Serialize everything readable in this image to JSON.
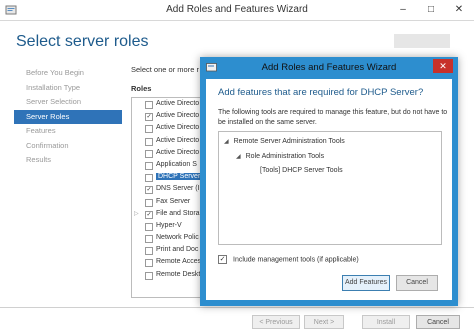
{
  "window": {
    "title": "Add Roles and Features Wizard"
  },
  "header": {
    "page_title": "Select server roles"
  },
  "sidebar": {
    "items": [
      {
        "label": "Before You Begin",
        "active": false
      },
      {
        "label": "Installation Type",
        "active": false
      },
      {
        "label": "Server Selection",
        "active": false
      },
      {
        "label": "Server Roles",
        "active": true
      },
      {
        "label": "Features",
        "active": false
      },
      {
        "label": "Confirmation",
        "active": false
      },
      {
        "label": "Results",
        "active": false
      }
    ]
  },
  "content": {
    "instruction": "Select one or more r",
    "roles_heading": "Roles",
    "roles": [
      {
        "label": "Active Directo",
        "checked": false,
        "expandable": false,
        "selected": false
      },
      {
        "label": "Active Directo",
        "checked": true,
        "expandable": false,
        "selected": false
      },
      {
        "label": "Active Directo",
        "checked": false,
        "expandable": false,
        "selected": false
      },
      {
        "label": "Active Directo",
        "checked": false,
        "expandable": false,
        "selected": false
      },
      {
        "label": "Active Directo",
        "checked": false,
        "expandable": false,
        "selected": false
      },
      {
        "label": "Application S",
        "checked": false,
        "expandable": false,
        "selected": false
      },
      {
        "label": "DHCP Server",
        "checked": false,
        "expandable": false,
        "selected": true
      },
      {
        "label": "DNS Server (I",
        "checked": true,
        "expandable": false,
        "selected": false
      },
      {
        "label": "Fax Server",
        "checked": false,
        "expandable": false,
        "selected": false
      },
      {
        "label": "File and Stora",
        "checked": true,
        "expandable": true,
        "selected": false
      },
      {
        "label": "Hyper-V",
        "checked": false,
        "expandable": false,
        "selected": false
      },
      {
        "label": "Network Polic",
        "checked": false,
        "expandable": false,
        "selected": false
      },
      {
        "label": "Print and Doc",
        "checked": false,
        "expandable": false,
        "selected": false
      },
      {
        "label": "Remote Access",
        "checked": false,
        "expandable": false,
        "selected": false
      },
      {
        "label": "Remote Deskt",
        "checked": false,
        "expandable": false,
        "selected": false
      }
    ]
  },
  "footer": {
    "previous_label": "< Previous",
    "next_label": "Next >",
    "install_label": "Install",
    "cancel_label": "Cancel"
  },
  "dialog": {
    "title": "Add Roles and Features Wizard",
    "heading": "Add features that are required for DHCP Server?",
    "description": "The following tools are required to manage this feature, but do not have to be installed on the same server.",
    "tree": [
      {
        "label": "Remote Server Administration Tools",
        "level": 0,
        "expanded": true
      },
      {
        "label": "Role Administration Tools",
        "level": 1,
        "expanded": true
      },
      {
        "label": "[Tools] DHCP Server Tools",
        "level": 2,
        "expanded": false
      }
    ],
    "include_label": "Include management tools (if applicable)",
    "include_checked": true,
    "add_label": "Add Features",
    "cancel_label": "Cancel"
  }
}
